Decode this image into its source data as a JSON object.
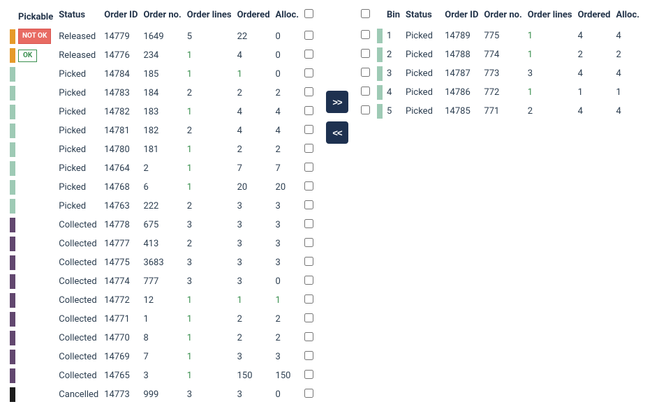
{
  "colors": {
    "orange": "#e69a2a",
    "green": "#9ecab5",
    "purple": "#62476f",
    "black": "#1c1c1c",
    "accent": "#1e3150",
    "green_text": "#3a8f4f",
    "badge_red": "#e86b63"
  },
  "left": {
    "headers": {
      "pickable": "Pickable",
      "status": "Status",
      "order_id": "Order ID",
      "order_no": "Order no.",
      "order_lines": "Order lines",
      "ordered": "Ordered",
      "alloc": "Alloc."
    },
    "rows": [
      {
        "color": "orange",
        "badge": "NOT OK",
        "badge_style": "notok",
        "status": "Released",
        "order_id": "14779",
        "order_no": "1649",
        "order_lines": "5",
        "lines_green": false,
        "ordered": "22",
        "ord_green": false,
        "alloc": "0",
        "alloc_green": false
      },
      {
        "color": "orange",
        "badge": "OK",
        "badge_style": "ok",
        "status": "Released",
        "order_id": "14776",
        "order_no": "234",
        "order_lines": "1",
        "lines_green": true,
        "ordered": "4",
        "ord_green": false,
        "alloc": "0",
        "alloc_green": false
      },
      {
        "color": "green",
        "badge": "",
        "badge_style": "",
        "status": "Picked",
        "order_id": "14784",
        "order_no": "185",
        "order_lines": "1",
        "lines_green": true,
        "ordered": "1",
        "ord_green": true,
        "alloc": "0",
        "alloc_green": false
      },
      {
        "color": "green",
        "badge": "",
        "badge_style": "",
        "status": "Picked",
        "order_id": "14783",
        "order_no": "184",
        "order_lines": "2",
        "lines_green": false,
        "ordered": "2",
        "ord_green": false,
        "alloc": "2",
        "alloc_green": false
      },
      {
        "color": "green",
        "badge": "",
        "badge_style": "",
        "status": "Picked",
        "order_id": "14782",
        "order_no": "183",
        "order_lines": "1",
        "lines_green": true,
        "ordered": "4",
        "ord_green": false,
        "alloc": "4",
        "alloc_green": false
      },
      {
        "color": "green",
        "badge": "",
        "badge_style": "",
        "status": "Picked",
        "order_id": "14781",
        "order_no": "182",
        "order_lines": "2",
        "lines_green": false,
        "ordered": "4",
        "ord_green": false,
        "alloc": "4",
        "alloc_green": false
      },
      {
        "color": "green",
        "badge": "",
        "badge_style": "",
        "status": "Picked",
        "order_id": "14780",
        "order_no": "181",
        "order_lines": "1",
        "lines_green": true,
        "ordered": "2",
        "ord_green": false,
        "alloc": "2",
        "alloc_green": false
      },
      {
        "color": "green",
        "badge": "",
        "badge_style": "",
        "status": "Picked",
        "order_id": "14764",
        "order_no": "2",
        "order_lines": "1",
        "lines_green": true,
        "ordered": "7",
        "ord_green": false,
        "alloc": "7",
        "alloc_green": false
      },
      {
        "color": "green",
        "badge": "",
        "badge_style": "",
        "status": "Picked",
        "order_id": "14768",
        "order_no": "6",
        "order_lines": "1",
        "lines_green": true,
        "ordered": "20",
        "ord_green": false,
        "alloc": "20",
        "alloc_green": false
      },
      {
        "color": "green",
        "badge": "",
        "badge_style": "",
        "status": "Picked",
        "order_id": "14763",
        "order_no": "222",
        "order_lines": "2",
        "lines_green": false,
        "ordered": "3",
        "ord_green": false,
        "alloc": "3",
        "alloc_green": false
      },
      {
        "color": "purple",
        "badge": "",
        "badge_style": "",
        "status": "Collected",
        "order_id": "14778",
        "order_no": "675",
        "order_lines": "3",
        "lines_green": false,
        "ordered": "3",
        "ord_green": false,
        "alloc": "3",
        "alloc_green": false
      },
      {
        "color": "purple",
        "badge": "",
        "badge_style": "",
        "status": "Collected",
        "order_id": "14777",
        "order_no": "413",
        "order_lines": "2",
        "lines_green": false,
        "ordered": "3",
        "ord_green": false,
        "alloc": "3",
        "alloc_green": false
      },
      {
        "color": "purple",
        "badge": "",
        "badge_style": "",
        "status": "Collected",
        "order_id": "14775",
        "order_no": "3683",
        "order_lines": "3",
        "lines_green": false,
        "ordered": "3",
        "ord_green": false,
        "alloc": "3",
        "alloc_green": false
      },
      {
        "color": "purple",
        "badge": "",
        "badge_style": "",
        "status": "Collected",
        "order_id": "14774",
        "order_no": "777",
        "order_lines": "3",
        "lines_green": false,
        "ordered": "3",
        "ord_green": false,
        "alloc": "0",
        "alloc_green": false
      },
      {
        "color": "purple",
        "badge": "",
        "badge_style": "",
        "status": "Collected",
        "order_id": "14772",
        "order_no": "12",
        "order_lines": "1",
        "lines_green": true,
        "ordered": "1",
        "ord_green": true,
        "alloc": "1",
        "alloc_green": true
      },
      {
        "color": "purple",
        "badge": "",
        "badge_style": "",
        "status": "Collected",
        "order_id": "14771",
        "order_no": "1",
        "order_lines": "1",
        "lines_green": true,
        "ordered": "2",
        "ord_green": false,
        "alloc": "2",
        "alloc_green": false
      },
      {
        "color": "purple",
        "badge": "",
        "badge_style": "",
        "status": "Collected",
        "order_id": "14770",
        "order_no": "8",
        "order_lines": "1",
        "lines_green": true,
        "ordered": "2",
        "ord_green": false,
        "alloc": "2",
        "alloc_green": false
      },
      {
        "color": "purple",
        "badge": "",
        "badge_style": "",
        "status": "Collected",
        "order_id": "14769",
        "order_no": "7",
        "order_lines": "1",
        "lines_green": true,
        "ordered": "3",
        "ord_green": false,
        "alloc": "3",
        "alloc_green": false
      },
      {
        "color": "purple",
        "badge": "",
        "badge_style": "",
        "status": "Collected",
        "order_id": "14765",
        "order_no": "3",
        "order_lines": "1",
        "lines_green": true,
        "ordered": "150",
        "ord_green": false,
        "alloc": "150",
        "alloc_green": false
      },
      {
        "color": "black",
        "badge": "",
        "badge_style": "",
        "status": "Cancelled",
        "order_id": "14773",
        "order_no": "999",
        "order_lines": "3",
        "lines_green": false,
        "ordered": "3",
        "ord_green": false,
        "alloc": "0",
        "alloc_green": false
      }
    ]
  },
  "arrows": {
    "right": ">>",
    "left": "<<"
  },
  "right": {
    "headers": {
      "bin": "Bin",
      "status": "Status",
      "order_id": "Order ID",
      "order_no": "Order no.",
      "order_lines": "Order lines",
      "ordered": "Ordered",
      "alloc": "Alloc."
    },
    "rows": [
      {
        "bin": "1",
        "status": "Picked",
        "order_id": "14789",
        "order_no": "775",
        "order_lines": "1",
        "lines_green": true,
        "ordered": "4",
        "alloc": "4"
      },
      {
        "bin": "2",
        "status": "Picked",
        "order_id": "14788",
        "order_no": "774",
        "order_lines": "1",
        "lines_green": true,
        "ordered": "2",
        "alloc": "2"
      },
      {
        "bin": "3",
        "status": "Picked",
        "order_id": "14787",
        "order_no": "773",
        "order_lines": "3",
        "lines_green": false,
        "ordered": "4",
        "alloc": "4"
      },
      {
        "bin": "4",
        "status": "Picked",
        "order_id": "14786",
        "order_no": "772",
        "order_lines": "1",
        "lines_green": true,
        "ordered": "1",
        "alloc": "1"
      },
      {
        "bin": "5",
        "status": "Picked",
        "order_id": "14785",
        "order_no": "771",
        "order_lines": "2",
        "lines_green": false,
        "ordered": "4",
        "alloc": "4"
      }
    ]
  }
}
